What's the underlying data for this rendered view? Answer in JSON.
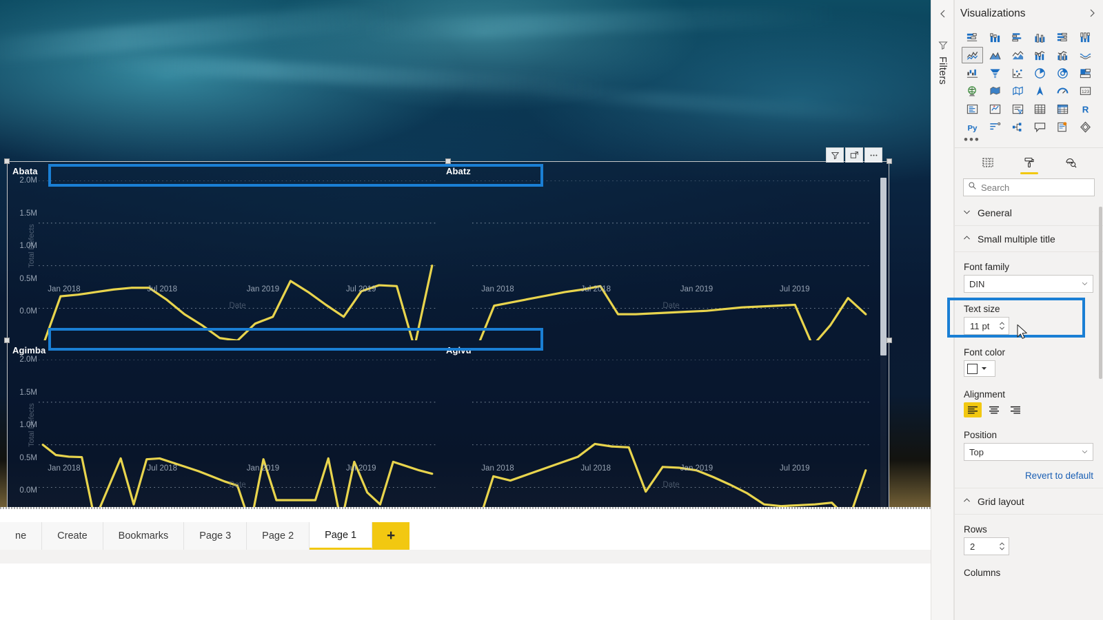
{
  "report": {
    "visual_header": {
      "filter_icon": "filter-icon",
      "focus_icon": "focus-mode-icon",
      "more_icon": "more-options-icon"
    }
  },
  "chart_data": {
    "type": "line",
    "title": "",
    "xlabel": "Date",
    "ylabel": "Total Defects",
    "ylim": [
      0,
      2000000
    ],
    "ytick_labels": [
      "0.0M",
      "0.5M",
      "1.0M",
      "1.5M",
      "2.0M"
    ],
    "ytick_values": [
      0,
      500000,
      1000000,
      1500000,
      2000000
    ],
    "xtick_labels": [
      "Jan 2018",
      "Jul 2018",
      "Jan 2019",
      "Jul 2019"
    ],
    "grid": true,
    "legend": "none",
    "line_color": "#e8d44d",
    "small_multiples": [
      {
        "title": "Abata",
        "values": [
          60000,
          640000,
          660000,
          690000,
          720000,
          740000,
          740000,
          600000,
          430000,
          300000,
          150000,
          120000,
          320000,
          400000,
          820000,
          690000,
          540000,
          400000,
          700000,
          770000,
          760000,
          40000,
          1000000
        ]
      },
      {
        "title": "Abatz",
        "values": [
          20000,
          530000,
          570000,
          610000,
          650000,
          690000,
          720000,
          760000,
          430000,
          430000,
          440000,
          450000,
          460000,
          470000,
          490000,
          510000,
          520000,
          530000,
          540000,
          60000,
          300000,
          620000,
          430000
        ]
      },
      {
        "title": "Agimba",
        "values": [
          1000000,
          880000,
          860000,
          855000,
          120000,
          480000,
          840000,
          300000,
          830000,
          840000,
          790000,
          740000,
          690000,
          630000,
          570000,
          520000,
          60000,
          830000,
          350000,
          350000,
          350000,
          350000,
          840000,
          80000,
          800000,
          440000,
          300000,
          800000,
          750000,
          700000,
          660000
        ]
      },
      {
        "title": "Agivu",
        "values": [
          10000,
          630000,
          580000,
          650000,
          720000,
          790000,
          860000,
          1010000,
          980000,
          970000,
          450000,
          740000,
          730000,
          700000,
          620000,
          530000,
          430000,
          300000,
          280000,
          290000,
          300000,
          320000,
          120000,
          700000
        ]
      }
    ]
  },
  "page_tabs": {
    "items": [
      {
        "label": "ne",
        "active": false
      },
      {
        "label": "Create",
        "active": false
      },
      {
        "label": "Bookmarks",
        "active": false
      },
      {
        "label": "Page 3",
        "active": false
      },
      {
        "label": "Page 2",
        "active": false
      },
      {
        "label": "Page 1",
        "active": true
      }
    ],
    "add_label": "+"
  },
  "filters_rail": {
    "label": "Filters",
    "collapse_icon": "chevron-left-icon",
    "funnel_icon": "funnel-icon"
  },
  "visualizations": {
    "title": "Visualizations",
    "expand_icon": "chevron-right-icon",
    "icons": [
      "stacked-bar-chart-icon",
      "stacked-column-chart-icon",
      "clustered-bar-chart-icon",
      "clustered-column-chart-icon",
      "100-stacked-bar-chart-icon",
      "100-stacked-column-chart-icon",
      "line-chart-icon",
      "area-chart-icon",
      "stacked-area-chart-icon",
      "line-stacked-column-chart-icon",
      "line-clustered-column-chart-icon",
      "ribbon-chart-icon",
      "waterfall-chart-icon",
      "funnel-chart-icon",
      "scatter-chart-icon",
      "pie-chart-icon",
      "donut-chart-icon",
      "treemap-icon",
      "map-icon",
      "filled-map-icon",
      "shape-map-icon",
      "arcgis-map-icon",
      "gauge-icon",
      "card-icon",
      "multi-row-card-icon",
      "kpi-icon",
      "slicer-icon",
      "table-icon",
      "matrix-icon",
      "r-script-visual-icon",
      "python-visual-icon",
      "key-influencers-icon",
      "decomposition-tree-icon",
      "q-and-a-icon",
      "paginated-report-icon",
      "power-apps-icon"
    ],
    "selected_icon_index": 6,
    "more_icon": "ellipsis-icon",
    "pane_tabs": [
      {
        "name": "fields-tab",
        "icon": "fields-table-icon",
        "active": false
      },
      {
        "name": "format-tab",
        "icon": "paint-roller-icon",
        "active": true
      },
      {
        "name": "analytics-tab",
        "icon": "magnifier-brush-icon",
        "active": false
      }
    ],
    "search_placeholder": "Search",
    "search_value": "",
    "search_icon": "search-icon"
  },
  "format_pane": {
    "sections": [
      {
        "name": "general",
        "label": "General",
        "expanded": false,
        "chevron": "chevron-down-icon"
      },
      {
        "name": "small-multiple-title",
        "label": "Small multiple title",
        "expanded": true,
        "chevron": "chevron-up-icon"
      },
      {
        "name": "grid-layout",
        "label": "Grid layout",
        "expanded": true,
        "chevron": "chevron-up-icon"
      }
    ],
    "small_multiple_title": {
      "font_family_label": "Font family",
      "font_family_value": "DIN",
      "text_size_label": "Text size",
      "text_size_value": "11",
      "text_size_unit": "pt",
      "font_color_label": "Font color",
      "font_color_value": "#ffffff",
      "alignment_label": "Alignment",
      "alignment_options": [
        "align-left-icon",
        "align-center-icon",
        "align-right-icon"
      ],
      "alignment_selected": 0,
      "position_label": "Position",
      "position_value": "Top",
      "revert_label": "Revert to default"
    },
    "grid_layout": {
      "rows_label": "Rows",
      "rows_value": "2",
      "columns_label": "Columns"
    }
  },
  "colors": {
    "accent_yellow": "#f2c811",
    "highlight_blue": "#1a7fd4",
    "line_yellow": "#e8d44d",
    "pane_bg": "#f3f2f1"
  }
}
